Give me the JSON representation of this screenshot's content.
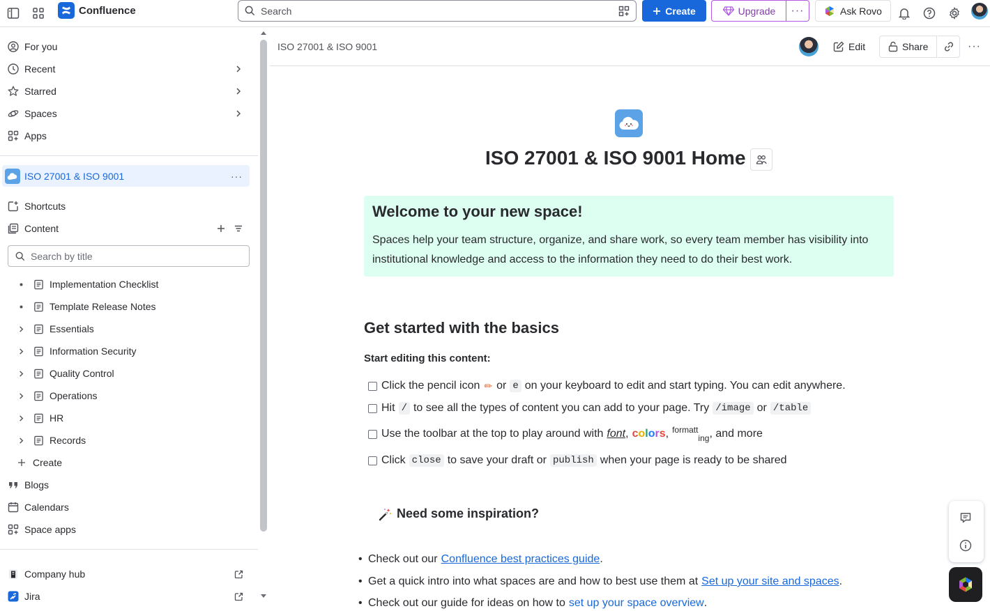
{
  "topbar": {
    "app_name": "Confluence",
    "search_placeholder": "Search",
    "create_label": "Create",
    "upgrade_label": "Upgrade",
    "rovo_label": "Ask Rovo",
    "brand_color": "#1868db"
  },
  "sidebar": {
    "nav": [
      {
        "label": "For you",
        "icon": "user-circle-icon"
      },
      {
        "label": "Recent",
        "icon": "clock-icon"
      },
      {
        "label": "Starred",
        "icon": "star-icon"
      },
      {
        "label": "Spaces",
        "icon": "orbit-icon"
      },
      {
        "label": "Apps",
        "icon": "apps-icon"
      }
    ],
    "space_name": "ISO 27001 & ISO 9001",
    "shortcuts_label": "Shortcuts",
    "content_label": "Content",
    "search_placeholder": "Search by title",
    "tree": [
      {
        "label": "Implementation Checklist",
        "expandable": false
      },
      {
        "label": "Template Release Notes",
        "expandable": false
      },
      {
        "label": "Essentials",
        "expandable": true
      },
      {
        "label": "Information Security",
        "expandable": true
      },
      {
        "label": "Quality Control",
        "expandable": true
      },
      {
        "label": "Operations",
        "expandable": true
      },
      {
        "label": "HR",
        "expandable": true
      },
      {
        "label": "Records",
        "expandable": true
      }
    ],
    "create_label": "Create",
    "blogs_label": "Blogs",
    "calendars_label": "Calendars",
    "space_apps_label": "Space apps",
    "company_hub_label": "Company hub",
    "jira_label": "Jira"
  },
  "header": {
    "breadcrumb": "ISO 27001 & ISO 9001",
    "edit_label": "Edit",
    "share_label": "Share"
  },
  "page": {
    "title": "ISO 27001 & ISO 9001 Home",
    "panel_title": "Welcome to your new space!",
    "panel_text": "Spaces help your team structure, organize, and share work, so every team member has visibility into institutional knowledge and access to the information they need to do their best work.",
    "basics_heading": "Get started with the basics",
    "editing_subheading": "Start editing this content:",
    "task1": {
      "a": "Click the pencil icon",
      "b": "or",
      "code": "e",
      "c": "on your keyboard to edit and start typing. You can edit anywhere."
    },
    "task2": {
      "a": "Hit",
      "code1": "/",
      "b": "to see all the types of content you can add to your page. Try",
      "code2": "/image",
      "c": "or",
      "code3": "/table"
    },
    "task3": {
      "a": "Use the toolbar at the top to play around with",
      "font": "font",
      "comma1": ",",
      "colors": [
        "c",
        "o",
        "l",
        "o",
        "r",
        "s"
      ],
      "comma2": ",",
      "sup": "formatt",
      "sub": "ing",
      "c": ", and more"
    },
    "task4": {
      "a": "Click",
      "code1": "close",
      "b": "to save your draft or",
      "code2": "publish",
      "c": "when your page is ready to be shared"
    },
    "inspire_heading": "Need some inspiration?",
    "bullets": [
      {
        "pre": "Check out our",
        "link": "Confluence best practices guide",
        "post": "."
      },
      {
        "pre": "Get a quick intro into what spaces are and how to best use them at",
        "link": "Set up your site and spaces",
        "post": "."
      },
      {
        "pre": "Check out our guide for ideas on how to",
        "link": "set up your space overview",
        "post": "."
      }
    ],
    "panel_color": "#dcfff1"
  }
}
